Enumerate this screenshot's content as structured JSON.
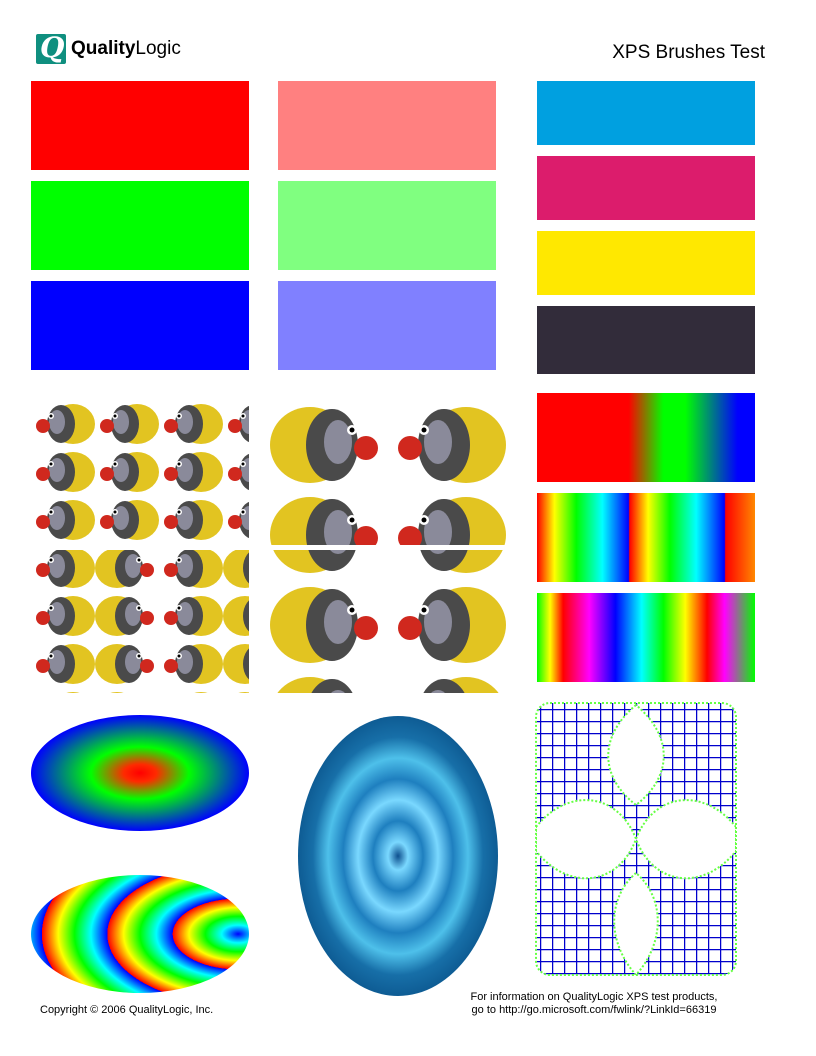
{
  "header": {
    "logo_bold": "Quality",
    "logo_light": "Logic",
    "logo_mark": "Q",
    "title": "XPS Brushes Test"
  },
  "footer": {
    "copyright": "Copyright © 2006 QualityLogic, Inc.",
    "info_line1": "For information on QualityLogic XPS test products,",
    "info_line2": "go to http://go.microsoft.com/fwlink/?LinkId=66319"
  },
  "colors": {
    "logo_teal": "#0f8f7f",
    "solid_red": "#ff0000",
    "solid_green": "#00ff00",
    "solid_blue": "#0000ff",
    "light_red": "#ff8080",
    "light_green": "#80ff80",
    "light_blue": "#8080ff",
    "cyan": "#00a0e0",
    "magenta": "#dc1c6c",
    "yellow": "#ffe800",
    "black": "#322c3a",
    "grid_blue": "#0000cc",
    "dot_green": "#66ff44"
  }
}
